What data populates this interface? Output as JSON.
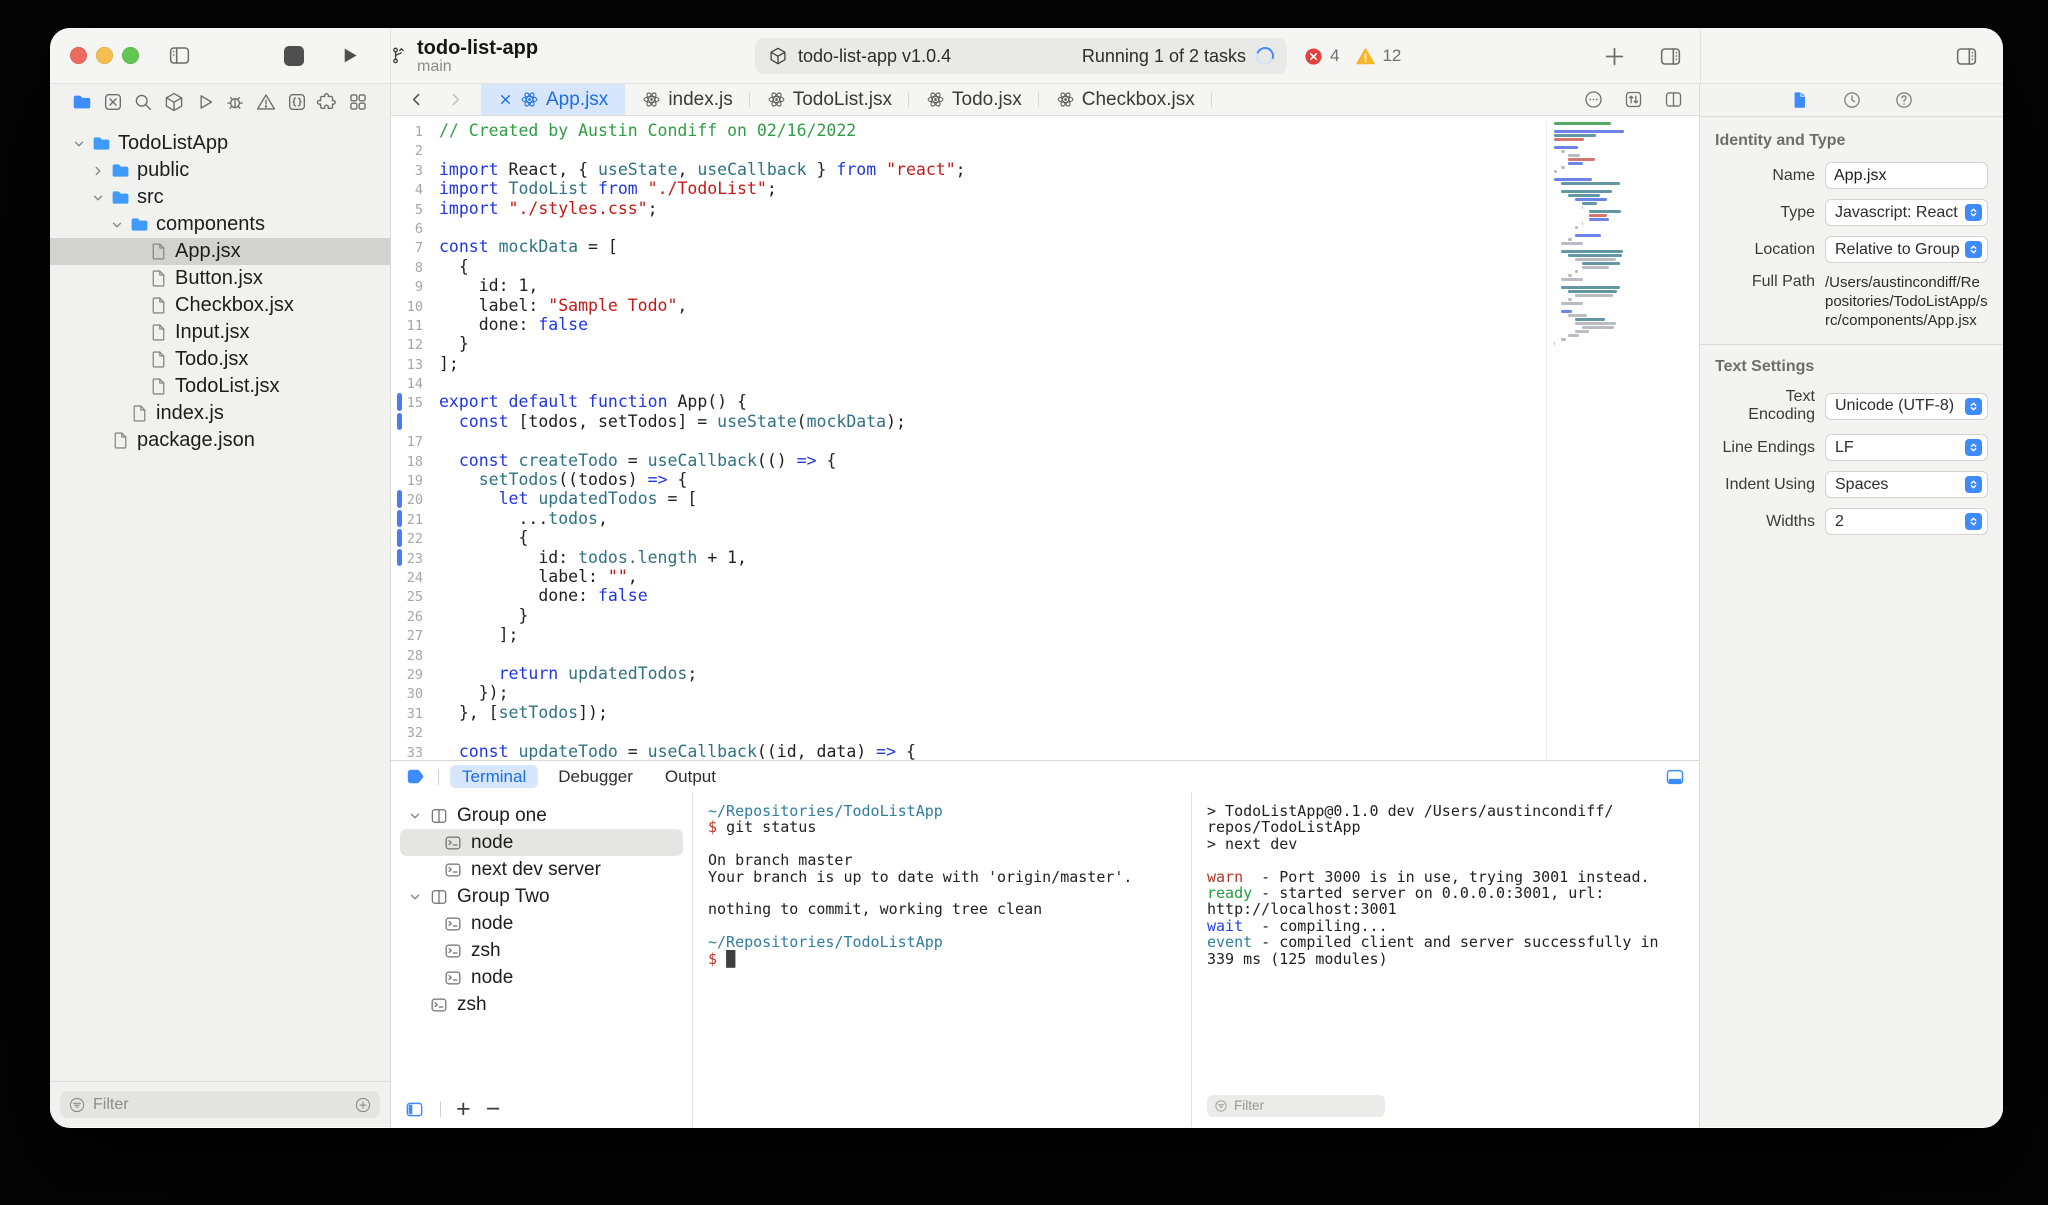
{
  "window": {
    "title": "todo-list-app",
    "branch": "main"
  },
  "titlebar": {
    "activity": {
      "project": "todo-list-app v1.0.4",
      "status": "Running 1 of 2 tasks",
      "errors": "4",
      "warnings": "12"
    },
    "accent": "#3d8bfd",
    "error_color": "#e2413c",
    "warning_color": "#f6b62c"
  },
  "navigator": {
    "icons": [
      "folder",
      "source-control",
      "search",
      "package",
      "play",
      "bug",
      "warning",
      "braces",
      "extension",
      "apps"
    ],
    "tree": [
      {
        "label": "TodoListApp",
        "type": "folder",
        "indent": 0,
        "chevron": "down"
      },
      {
        "label": "public",
        "type": "folder",
        "indent": 1,
        "chevron": "right"
      },
      {
        "label": "src",
        "type": "folder",
        "indent": 1,
        "chevron": "down"
      },
      {
        "label": "components",
        "type": "folder",
        "indent": 2,
        "chevron": "down"
      },
      {
        "label": "App.jsx",
        "type": "file",
        "indent": 3,
        "selected": true
      },
      {
        "label": "Button.jsx",
        "type": "file",
        "indent": 3
      },
      {
        "label": "Checkbox.jsx",
        "type": "file",
        "indent": 3
      },
      {
        "label": "Input.jsx",
        "type": "file",
        "indent": 3
      },
      {
        "label": "Todo.jsx",
        "type": "file",
        "indent": 3
      },
      {
        "label": "TodoList.jsx",
        "type": "file",
        "indent": 3
      },
      {
        "label": "index.js",
        "type": "file",
        "indent": 2
      },
      {
        "label": "package.json",
        "type": "file",
        "indent": 1
      }
    ],
    "filter_placeholder": "Filter"
  },
  "editor": {
    "tabs": [
      {
        "label": "App.jsx",
        "active": true
      },
      {
        "label": "index.js"
      },
      {
        "label": "TodoList.jsx"
      },
      {
        "label": "Todo.jsx"
      },
      {
        "label": "Checkbox.jsx"
      }
    ],
    "changed_lines": [
      15,
      16,
      20,
      21,
      22,
      23
    ],
    "code": [
      {
        "n": "1",
        "t": [
          [
            "c",
            "// Created by Austin Condiff on 02/16/2022"
          ]
        ]
      },
      {
        "n": "2",
        "t": []
      },
      {
        "n": "3",
        "t": [
          [
            "k",
            "import"
          ],
          [
            "p",
            " React, { "
          ],
          [
            "t",
            "useState"
          ],
          [
            "p",
            ", "
          ],
          [
            "t",
            "useCallback"
          ],
          [
            "p",
            " } "
          ],
          [
            "k",
            "from"
          ],
          [
            "p",
            " "
          ],
          [
            "s",
            "\"react\""
          ],
          [
            "p",
            ";"
          ]
        ]
      },
      {
        "n": "4",
        "t": [
          [
            "k",
            "import"
          ],
          [
            "p",
            " "
          ],
          [
            "t",
            "TodoList"
          ],
          [
            "p",
            " "
          ],
          [
            "k",
            "from"
          ],
          [
            "p",
            " "
          ],
          [
            "s",
            "\"./TodoList\""
          ],
          [
            "p",
            ";"
          ]
        ]
      },
      {
        "n": "5",
        "t": [
          [
            "k",
            "import"
          ],
          [
            "p",
            " "
          ],
          [
            "s",
            "\"./styles.css\""
          ],
          [
            "p",
            ";"
          ]
        ]
      },
      {
        "n": "6",
        "t": []
      },
      {
        "n": "7",
        "t": [
          [
            "k",
            "const"
          ],
          [
            "p",
            " "
          ],
          [
            "t",
            "mockData"
          ],
          [
            "p",
            " = ["
          ]
        ]
      },
      {
        "n": "8",
        "t": [
          [
            "p",
            "  {"
          ]
        ]
      },
      {
        "n": "9",
        "t": [
          [
            "p",
            "    id: 1,"
          ]
        ]
      },
      {
        "n": "10",
        "t": [
          [
            "p",
            "    label: "
          ],
          [
            "s",
            "\"Sample Todo\""
          ],
          [
            "p",
            ","
          ]
        ]
      },
      {
        "n": "11",
        "t": [
          [
            "p",
            "    done: "
          ],
          [
            "k",
            "false"
          ]
        ]
      },
      {
        "n": "12",
        "t": [
          [
            "p",
            "  }"
          ]
        ]
      },
      {
        "n": "13",
        "t": [
          [
            "p",
            "];"
          ]
        ]
      },
      {
        "n": "14",
        "t": []
      },
      {
        "n": "15",
        "t": [
          [
            "k",
            "export"
          ],
          [
            "p",
            " "
          ],
          [
            "k",
            "default"
          ],
          [
            "p",
            " "
          ],
          [
            "k",
            "function"
          ],
          [
            "p",
            " App() {"
          ]
        ]
      },
      {
        "n": "",
        "t": [
          [
            "p",
            "  "
          ],
          [
            "k",
            "const"
          ],
          [
            "p",
            " [todos, setTodos] = "
          ],
          [
            "t",
            "useState"
          ],
          [
            "p",
            "("
          ],
          [
            "t",
            "mockData"
          ],
          [
            "p",
            ");"
          ]
        ]
      },
      {
        "n": "17",
        "t": []
      },
      {
        "n": "18",
        "t": [
          [
            "p",
            "  "
          ],
          [
            "k",
            "const"
          ],
          [
            "p",
            " "
          ],
          [
            "t",
            "createTodo"
          ],
          [
            "p",
            " = "
          ],
          [
            "t",
            "useCallback"
          ],
          [
            "p",
            "(() "
          ],
          [
            "k",
            "=>"
          ],
          [
            "p",
            " {"
          ]
        ]
      },
      {
        "n": "19",
        "t": [
          [
            "p",
            "    "
          ],
          [
            "t",
            "setTodos"
          ],
          [
            "p",
            "((todos) "
          ],
          [
            "k",
            "=>"
          ],
          [
            "p",
            " {"
          ]
        ]
      },
      {
        "n": "20",
        "t": [
          [
            "p",
            "      "
          ],
          [
            "k",
            "let"
          ],
          [
            "p",
            " "
          ],
          [
            "t",
            "updatedTodos"
          ],
          [
            "p",
            " = ["
          ]
        ]
      },
      {
        "n": "21",
        "t": [
          [
            "p",
            "        ..."
          ],
          [
            "t",
            "todos"
          ],
          [
            "p",
            ","
          ]
        ]
      },
      {
        "n": "22",
        "t": [
          [
            "p",
            "        {"
          ]
        ]
      },
      {
        "n": "23",
        "t": [
          [
            "p",
            "          id: "
          ],
          [
            "t",
            "todos.length"
          ],
          [
            "p",
            " + 1,"
          ]
        ]
      },
      {
        "n": "24",
        "t": [
          [
            "p",
            "          label: "
          ],
          [
            "s",
            "\"\""
          ],
          [
            "p",
            ","
          ]
        ]
      },
      {
        "n": "25",
        "t": [
          [
            "p",
            "          done: "
          ],
          [
            "k",
            "false"
          ]
        ]
      },
      {
        "n": "26",
        "t": [
          [
            "p",
            "        }"
          ]
        ]
      },
      {
        "n": "27",
        "t": [
          [
            "p",
            "      ];"
          ]
        ]
      },
      {
        "n": "28",
        "t": []
      },
      {
        "n": "29",
        "t": [
          [
            "p",
            "      "
          ],
          [
            "k",
            "return"
          ],
          [
            "p",
            " "
          ],
          [
            "t",
            "updatedTodos"
          ],
          [
            "p",
            ";"
          ]
        ]
      },
      {
        "n": "30",
        "t": [
          [
            "p",
            "    });"
          ]
        ]
      },
      {
        "n": "31",
        "t": [
          [
            "p",
            "  }, ["
          ],
          [
            "t",
            "setTodos"
          ],
          [
            "p",
            "]);"
          ]
        ]
      },
      {
        "n": "32",
        "t": []
      },
      {
        "n": "33",
        "t": [
          [
            "p",
            "  "
          ],
          [
            "k",
            "const"
          ],
          [
            "p",
            " "
          ],
          [
            "t",
            "updateTodo"
          ],
          [
            "p",
            " = "
          ],
          [
            "t",
            "useCallback"
          ],
          [
            "p",
            "((id, data) "
          ],
          [
            "k",
            "=>"
          ],
          [
            "p",
            " {"
          ]
        ]
      }
    ]
  },
  "minimap": [
    [
      0,
      42,
      "g"
    ],
    [
      0,
      0,
      ""
    ],
    [
      0,
      52,
      "k"
    ],
    [
      0,
      31,
      "t"
    ],
    [
      0,
      22,
      "r"
    ],
    [
      0,
      0,
      ""
    ],
    [
      0,
      18,
      "k"
    ],
    [
      1,
      3,
      "p"
    ],
    [
      2,
      9,
      "p"
    ],
    [
      2,
      20,
      "r"
    ],
    [
      2,
      11,
      "k"
    ],
    [
      1,
      3,
      "p"
    ],
    [
      0,
      2,
      "p"
    ],
    [
      0,
      0,
      ""
    ],
    [
      0,
      28,
      "k"
    ],
    [
      1,
      44,
      "t"
    ],
    [
      0,
      0,
      ""
    ],
    [
      1,
      38,
      "t"
    ],
    [
      2,
      24,
      "t"
    ],
    [
      3,
      24,
      "k"
    ],
    [
      4,
      11,
      "t"
    ],
    [
      4,
      1,
      "p"
    ],
    [
      5,
      24,
      "t"
    ],
    [
      5,
      13,
      "r"
    ],
    [
      5,
      15,
      "k"
    ],
    [
      4,
      1,
      "p"
    ],
    [
      3,
      2,
      "p"
    ],
    [
      0,
      0,
      ""
    ],
    [
      3,
      19,
      "k"
    ],
    [
      2,
      3,
      "p"
    ],
    [
      1,
      16,
      "p"
    ],
    [
      0,
      0,
      ""
    ],
    [
      1,
      46,
      "t"
    ],
    [
      2,
      40,
      "t"
    ],
    [
      3,
      30,
      "p"
    ],
    [
      4,
      28,
      "t"
    ],
    [
      4,
      20,
      "p"
    ],
    [
      3,
      2,
      "p"
    ],
    [
      2,
      3,
      "p"
    ],
    [
      1,
      16,
      "p"
    ],
    [
      0,
      0,
      ""
    ],
    [
      1,
      44,
      "t"
    ],
    [
      2,
      36,
      "t"
    ],
    [
      3,
      28,
      "p"
    ],
    [
      2,
      3,
      "p"
    ],
    [
      1,
      16,
      "p"
    ],
    [
      0,
      0,
      ""
    ],
    [
      1,
      8,
      "k"
    ],
    [
      2,
      14,
      "p"
    ],
    [
      3,
      22,
      "t"
    ],
    [
      3,
      30,
      "p"
    ],
    [
      4,
      24,
      "p"
    ],
    [
      3,
      10,
      "p"
    ],
    [
      2,
      8,
      "p"
    ],
    [
      1,
      4,
      "p"
    ],
    [
      0,
      1,
      "p"
    ]
  ],
  "inspector": {
    "identity_header": "Identity and Type",
    "name_label": "Name",
    "name_value": "App.jsx",
    "type_label": "Type",
    "type_value": "Javascript: React",
    "location_label": "Location",
    "location_value": "Relative to Group",
    "fullpath_label": "Full Path",
    "fullpath_value": "/Users/austincondiff/Repositories/TodoListApp/src/components/App.jsx",
    "textsettings_header": "Text Settings",
    "encoding_label": "Text Encoding",
    "encoding_value": "Unicode (UTF-8)",
    "lineendings_label": "Line Endings",
    "lineendings_value": "LF",
    "indent_label": "Indent Using",
    "indent_value": "Spaces",
    "widths_label": "Widths",
    "widths_value": "2"
  },
  "terminal": {
    "tabs": [
      "Terminal",
      "Debugger",
      "Output"
    ],
    "sessions": [
      {
        "label": "Group one",
        "type": "group",
        "indent": 0
      },
      {
        "label": "node",
        "type": "term",
        "indent": 1,
        "selected": true
      },
      {
        "label": "next dev server",
        "type": "term",
        "indent": 1
      },
      {
        "label": "Group Two",
        "type": "group",
        "indent": 0
      },
      {
        "label": "node",
        "type": "term",
        "indent": 1
      },
      {
        "label": "zsh",
        "type": "term",
        "indent": 1
      },
      {
        "label": "node",
        "type": "term",
        "indent": 1
      },
      {
        "label": "zsh",
        "type": "term",
        "indent": 0
      }
    ],
    "git_lines": [
      [
        [
          "path",
          "~/Repositories/TodoListApp"
        ]
      ],
      [
        [
          "prompt",
          "$ "
        ],
        [
          "cmd",
          "git status"
        ]
      ],
      [],
      [
        [
          "out",
          "On branch master"
        ]
      ],
      [
        [
          "out",
          "Your branch is up to date with 'origin/master'."
        ]
      ],
      [],
      [
        [
          "out",
          "nothing to commit, working tree clean"
        ]
      ],
      [],
      [
        [
          "path",
          "~/Repositories/TodoListApp"
        ]
      ],
      [
        [
          "prompt",
          "$ "
        ],
        [
          "cursor",
          "█"
        ]
      ]
    ],
    "dev_lines": [
      [
        [
          "out",
          "> TodoListApp@0.1.0 dev /Users/austincondiff/"
        ]
      ],
      [
        [
          "out",
          "repos/TodoListApp"
        ]
      ],
      [
        [
          "out",
          "> next dev"
        ]
      ],
      [],
      [
        [
          "warn",
          "warn"
        ],
        [
          "out",
          "  - Port 3000 is in use, trying 3001 instead."
        ]
      ],
      [
        [
          "ready",
          "ready"
        ],
        [
          "out",
          " - started server on 0.0.0.0:3001, url:"
        ]
      ],
      [
        [
          "out",
          "http://localhost:3001"
        ]
      ],
      [
        [
          "wait",
          "wait"
        ],
        [
          "out",
          "  - compiling..."
        ]
      ],
      [
        [
          "event",
          "event"
        ],
        [
          "out",
          " - compiled client and server successfully in"
        ]
      ],
      [
        [
          "out",
          "339 ms (125 modules)"
        ]
      ]
    ],
    "filter_placeholder": "Filter"
  }
}
